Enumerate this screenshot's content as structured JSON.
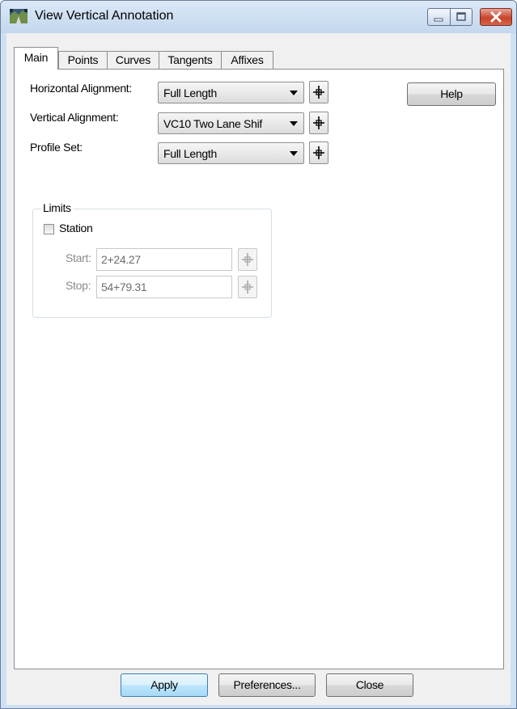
{
  "window": {
    "title": "View Vertical Annotation"
  },
  "tabs": [
    {
      "label": "Main"
    },
    {
      "label": "Points"
    },
    {
      "label": "Curves"
    },
    {
      "label": "Tangents"
    },
    {
      "label": "Affixes"
    }
  ],
  "main": {
    "horizontal_alignment": {
      "label": "Horizontal Alignment:",
      "value": "Full Length"
    },
    "vertical_alignment": {
      "label": "Vertical Alignment:",
      "value": "VC10 Two Lane Shif"
    },
    "profile_set": {
      "label": "Profile Set:",
      "value": "Full Length"
    },
    "help_label": "Help",
    "limits": {
      "title": "Limits",
      "station_label": "Station",
      "station_checked": false,
      "start_label": "Start:",
      "start_value": "2+24.27",
      "stop_label": "Stop:",
      "stop_value": "54+79.31"
    }
  },
  "footer": {
    "apply_label": "Apply",
    "preferences_label": "Preferences...",
    "close_label": "Close"
  },
  "icons": {
    "app": "road-profile-icon",
    "minimize": "minimize-icon",
    "maximize": "maximize-icon",
    "close": "close-icon",
    "pick": "crosshair-icon"
  }
}
